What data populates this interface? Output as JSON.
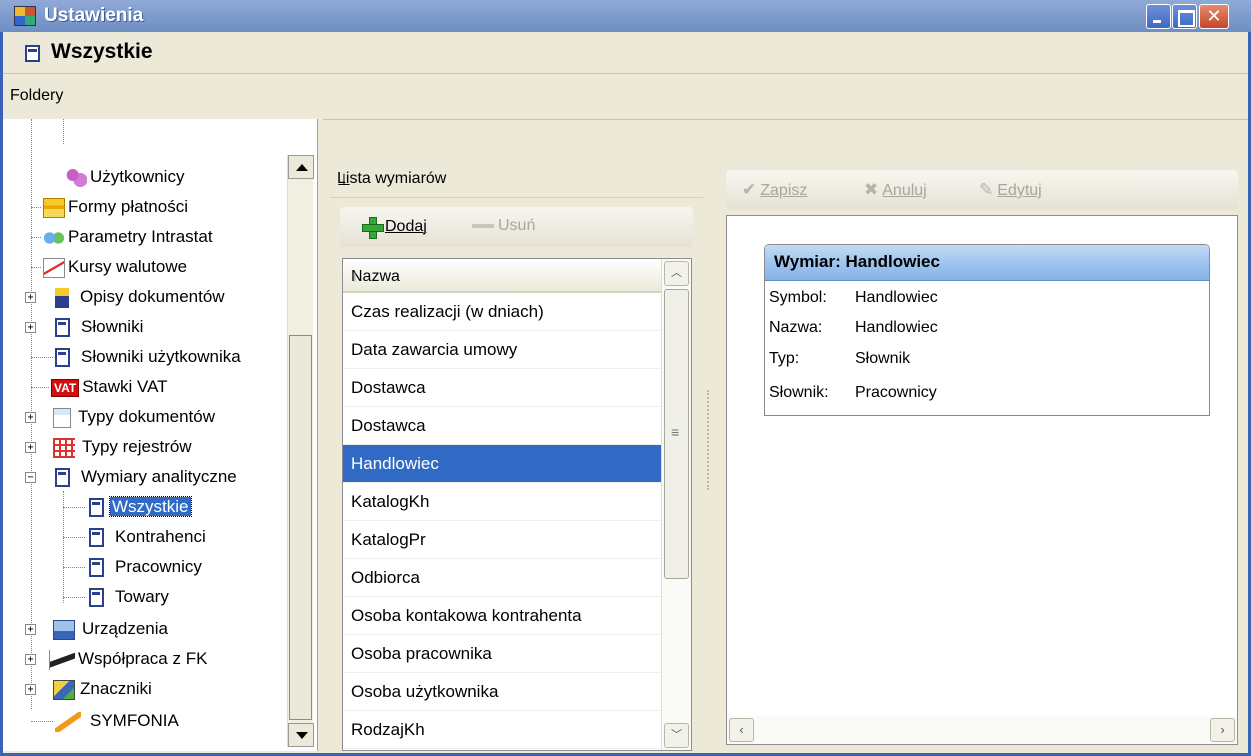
{
  "window": {
    "title": "Ustawienia"
  },
  "header": {
    "title": "Wszystkie"
  },
  "folders": {
    "title": "Foldery",
    "items": [
      {
        "label": "Użytkownicy",
        "icon": "users-icon"
      },
      {
        "label": "Formy płatności",
        "icon": "payment-forms-icon"
      },
      {
        "label": "Parametry Intrastat",
        "icon": "intrastat-icon"
      },
      {
        "label": "Kursy walutowe",
        "icon": "exchange-rates-icon"
      },
      {
        "label": "Opisy dokumentów",
        "icon": "document-icon"
      },
      {
        "label": "Słowniki",
        "icon": "document-icon"
      },
      {
        "label": "Słowniki użytkownika",
        "icon": "document-icon"
      },
      {
        "label": "Stawki VAT",
        "icon": "vat-icon",
        "badge": "VAT"
      },
      {
        "label": "Typy dokumentów",
        "icon": "doc-types-icon"
      },
      {
        "label": "Typy rejestrów",
        "icon": "registers-icon"
      },
      {
        "label": "Wymiary analityczne",
        "icon": "document-icon"
      },
      {
        "label": "Wszystkie",
        "icon": "document-icon"
      },
      {
        "label": "Kontrahenci",
        "icon": "document-icon"
      },
      {
        "label": "Pracownicy",
        "icon": "document-icon"
      },
      {
        "label": "Towary",
        "icon": "document-icon"
      },
      {
        "label": "Urządzenia",
        "icon": "devices-icon"
      },
      {
        "label": "Współpraca z FK",
        "icon": "fk-icon"
      },
      {
        "label": "Znaczniki",
        "icon": "markers-icon"
      },
      {
        "label": "SYMFONIA",
        "icon": "symfonia-icon"
      }
    ],
    "selected": "Wszystkie"
  },
  "list": {
    "title": "Lista wymiarów",
    "add_label": "Dodaj",
    "remove_label": "Usuń",
    "column": "Nazwa",
    "rows": [
      "Czas realizacji (w dniach)",
      "Data zawarcia umowy",
      "Dostawca",
      "Dostawca",
      "Handlowiec",
      "KatalogKh",
      "KatalogPr",
      "Odbiorca",
      "Osoba kontakowa kontrahenta",
      "Osoba pracownika",
      "Osoba użytkownika",
      "RodzajKh"
    ],
    "selected": "Handlowiec"
  },
  "detail": {
    "save_label": "Zapisz",
    "cancel_label": "Anuluj",
    "edit_label": "Edytuj",
    "card_title": "Wymiar: Handlowiec",
    "fields": [
      {
        "label": "Symbol:",
        "value": "Handlowiec"
      },
      {
        "label": "Nazwa:",
        "value": "Handlowiec"
      },
      {
        "label": "Typ:",
        "value": "Słownik"
      },
      {
        "label": "Słownik:",
        "value": "Pracownicy"
      }
    ]
  },
  "colors": {
    "selection": "#316ac5",
    "titlebar": "#7f9ccc",
    "face": "#ece9d8"
  }
}
